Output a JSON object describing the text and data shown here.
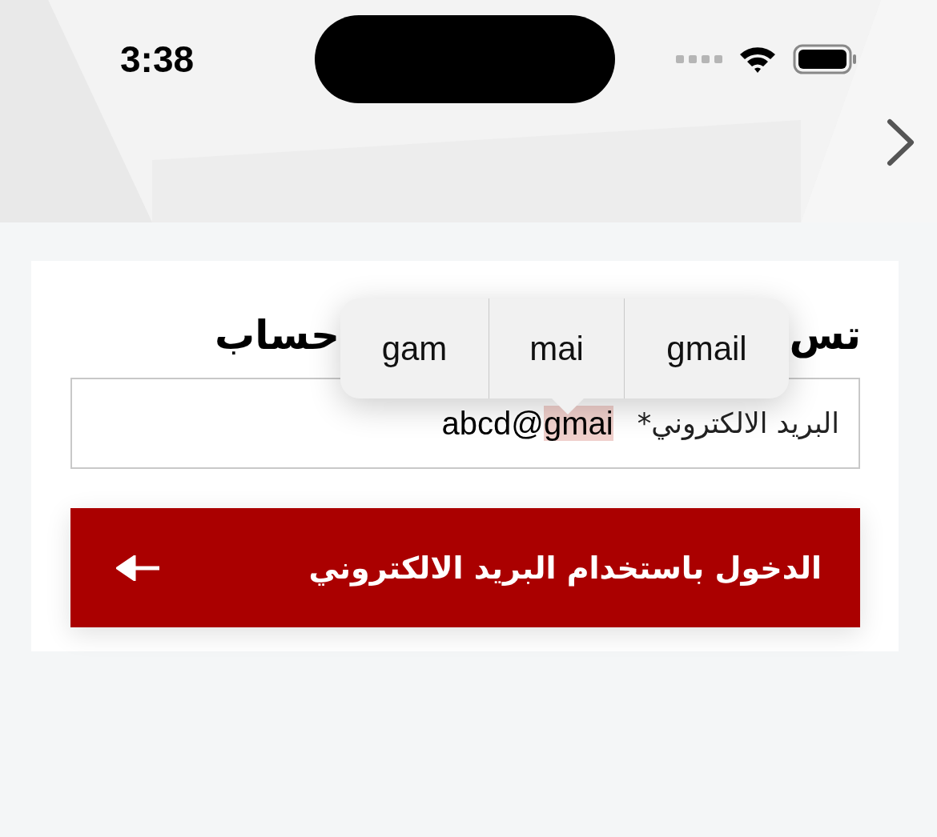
{
  "status_bar": {
    "time": "3:38"
  },
  "login_card": {
    "title_parts": [
      "تس",
      "حساب"
    ],
    "autocomplete": {
      "suggestions": [
        {
          "text": "gmail"
        },
        {
          "text": "mai"
        },
        {
          "text": "gam"
        }
      ]
    },
    "email_field": {
      "label": "البريد الالكتروني*",
      "value_parts": {
        "before": "abcd@",
        "selected": "gmai"
      }
    },
    "submit_button": {
      "label": "الدخول باستخدام البريد الالكتروني"
    }
  }
}
